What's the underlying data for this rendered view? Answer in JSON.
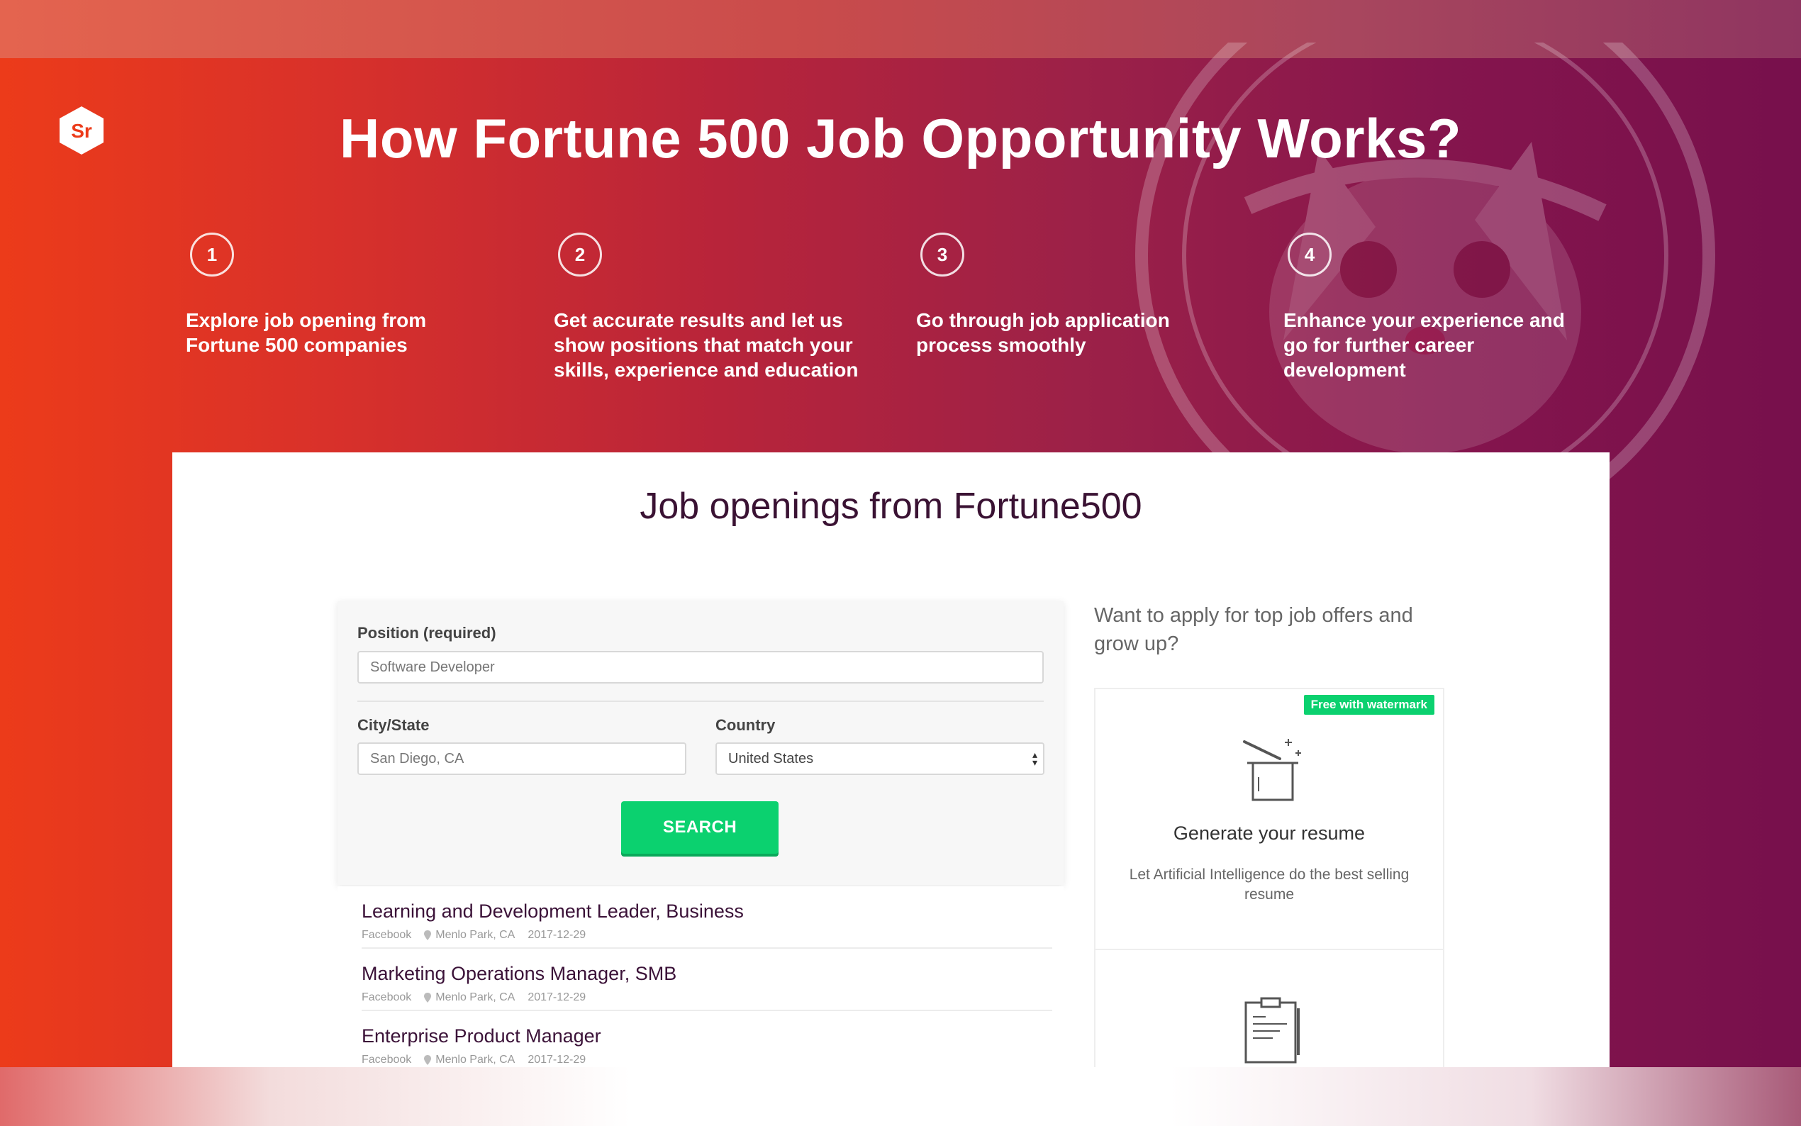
{
  "hero": {
    "title": "How Fortune 500 Job Opportunity Works?"
  },
  "steps": [
    {
      "number": "1",
      "text": "Explore job opening from Fortune 500 companies"
    },
    {
      "number": "2",
      "text": "Get accurate results and let us show positions that match your skills, experience and education"
    },
    {
      "number": "3",
      "text": "Go through job application process smoothly"
    },
    {
      "number": "4",
      "text": "Enhance your experience and go for further career development"
    }
  ],
  "section": {
    "title": "Job openings from Fortune500"
  },
  "form": {
    "position_label": "Position (required)",
    "position_placeholder": "Software Developer",
    "city_label": "City/State",
    "city_placeholder": "San Diego, CA",
    "country_label": "Country",
    "country_value": "United States",
    "search_label": "SEARCH"
  },
  "jobs": [
    {
      "title": "Learning and Development Leader, Business",
      "company": "Facebook",
      "location": "Menlo Park, CA",
      "date": "2017-12-29"
    },
    {
      "title": "Marketing Operations Manager, SMB",
      "company": "Facebook",
      "location": "Menlo Park, CA",
      "date": "2017-12-29"
    },
    {
      "title": "Enterprise Product Manager",
      "company": "Facebook",
      "location": "Menlo Park, CA",
      "date": "2017-12-29"
    }
  ],
  "sidebar": {
    "question": "Want to apply for top job offers and grow up?",
    "offer": {
      "badge": "Free with watermark",
      "title": "Generate your resume",
      "description": "Let Artificial Intelligence do the best selling resume"
    }
  },
  "logo": {
    "text": "Sr"
  },
  "colors": {
    "accent_green": "#0bd16f",
    "hero_start": "#ec3b1a",
    "hero_end": "#77104c",
    "title_dark": "#3a1233"
  },
  "icons": [
    "logo-icon",
    "magic-hat-icon",
    "clipboard-icon",
    "location-pin-icon",
    "select-caret-icon"
  ]
}
